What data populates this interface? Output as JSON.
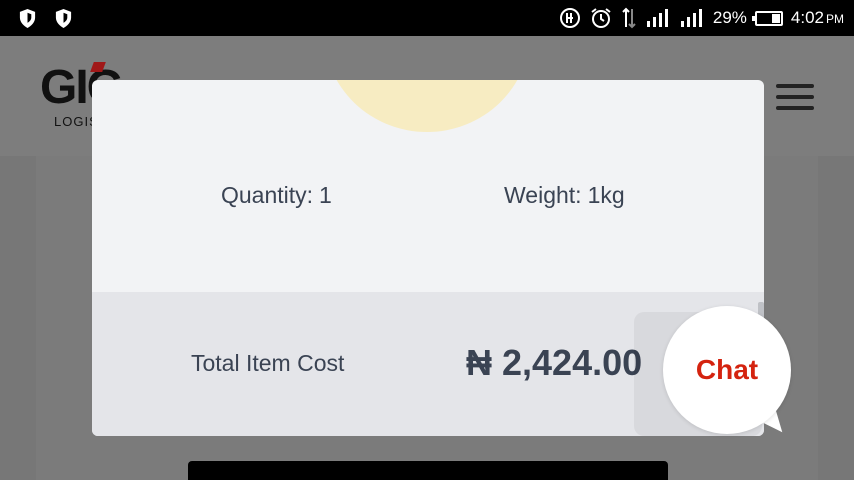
{
  "status_bar": {
    "battery_percent": "29%",
    "time": "4:02",
    "ampm": "PM"
  },
  "header": {
    "logo_text": "GIG",
    "logo_subtext": "LOGIS"
  },
  "modal": {
    "quantity_label": "Quantity:",
    "quantity_value": "1",
    "weight_label": "Weight:",
    "weight_value": "1kg",
    "total_label": "Total Item Cost",
    "total_value": "₦ 2,424.00"
  },
  "chat": {
    "label": "Chat"
  },
  "colors": {
    "status_bar_bg": "#000000",
    "overlay": "#777777",
    "modal_bg": "#f2f3f5",
    "total_row_bg": "#e4e5e9",
    "text": "#3a4353",
    "chat_text": "#d4230f",
    "item_image": "#f7ecc2"
  }
}
